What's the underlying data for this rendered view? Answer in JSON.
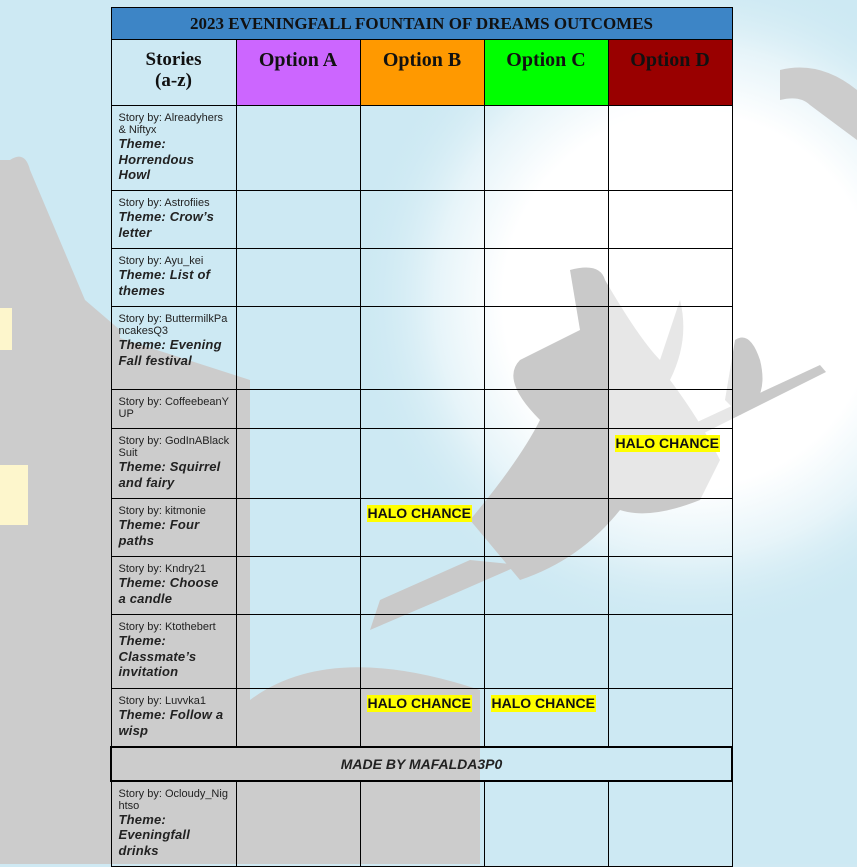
{
  "table": {
    "title": "2023 EVENINGFALL FOUNTAIN OF DREAMS OUTCOMES",
    "columns": {
      "stories": [
        "Stories",
        "(a-z)"
      ],
      "options": [
        "Option A",
        "Option B",
        "Option C",
        "Option D"
      ]
    },
    "option_colors": [
      "#cc66ff",
      "#ff9900",
      "#00ff00",
      "#990000"
    ],
    "title_color": "#3d85c6",
    "outcome_highlight_color": "#ffff00",
    "rows": [
      {
        "by": "Story by: Alreadyhers & Niftyx",
        "theme": "Theme: Horrendous Howl",
        "outcomes": [
          "",
          "",
          "",
          ""
        ]
      },
      {
        "by": "Story by: Astrofiies",
        "theme": "Theme: Crow’s letter",
        "outcomes": [
          "",
          "",
          "",
          ""
        ]
      },
      {
        "by": "Story by: Ayu_kei",
        "theme": "Theme: List of themes",
        "outcomes": [
          "",
          "",
          "",
          ""
        ]
      },
      {
        "by": "Story by: ButtermilkPancakesQ3",
        "theme": "Theme: Evening Fall festival",
        "outcomes": [
          "",
          "",
          "",
          ""
        ]
      },
      {
        "by": "Story by: CoffeebeanYUP",
        "theme": "",
        "outcomes": [
          "",
          "",
          "",
          ""
        ]
      },
      {
        "by": "Story by: GodInABlackSuit",
        "theme": "Theme: Squirrel and fairy",
        "outcomes": [
          "",
          "",
          "",
          "HALO CHANCE"
        ]
      },
      {
        "by": "Story by: kitmonie",
        "theme": "Theme: Four paths",
        "outcomes": [
          "",
          "HALO CHANCE",
          "",
          ""
        ]
      },
      {
        "by": "Story by: Kndry21",
        "theme": "Theme: Choose a candle",
        "outcomes": [
          "",
          "",
          "",
          ""
        ]
      },
      {
        "by": "Story by: Ktothebert",
        "theme": "Theme: Classmate’s invitation",
        "outcomes": [
          "",
          "",
          "",
          ""
        ]
      },
      {
        "by": "Story by: Luvvka1",
        "theme": "Theme: Follow a wisp",
        "outcomes": [
          "",
          "HALO CHANCE",
          "HALO CHANCE",
          ""
        ]
      }
    ],
    "banner": "MADE BY MAFALDA3P0",
    "rows_after_banner": [
      {
        "by": "Story by: Ocloudy_Nightso",
        "theme": "Theme: Eveningfall drinks",
        "outcomes": [
          "",
          "",
          "",
          ""
        ]
      }
    ]
  }
}
